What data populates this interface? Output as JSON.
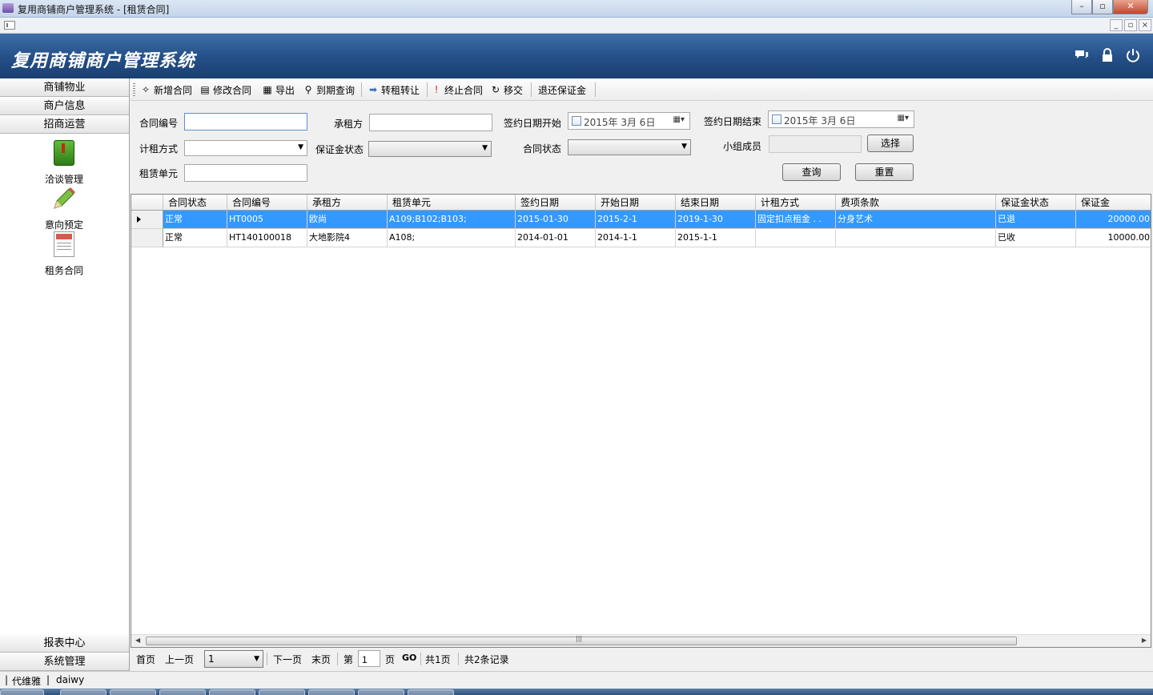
{
  "window": {
    "title": "复用商铺商户管理系统 - [租赁合同]",
    "controls": [
      "–",
      "▫",
      "✕"
    ],
    "mdi_controls": [
      "_",
      "▫",
      "×"
    ]
  },
  "banner": {
    "title": "复用商铺商户管理系统",
    "icons": [
      "chat-icon",
      "lock-icon",
      "power-icon"
    ]
  },
  "sidebar": {
    "top_headers": [
      "商铺物业",
      "商户信息",
      "招商运营"
    ],
    "items": [
      {
        "label": "洽谈管理",
        "icon": "green-book-icon"
      },
      {
        "label": "意向预定",
        "icon": "pencil-icon"
      },
      {
        "label": "租务合同",
        "icon": "contract-doc-icon"
      }
    ],
    "bottom_headers": [
      "报表中心",
      "系统管理"
    ]
  },
  "toolbar": {
    "buttons": [
      {
        "label": "新增合同",
        "icon": "new-icon"
      },
      {
        "label": "修改合同",
        "icon": "edit-icon"
      },
      {
        "label": "导出",
        "icon": "export-icon"
      },
      {
        "label": "到期查询",
        "icon": "search-icon"
      },
      {
        "label": "转租转让",
        "icon": "arrow-right-icon"
      },
      {
        "label": "终止合同",
        "icon": "exclamation-icon"
      },
      {
        "label": "移交",
        "icon": "refresh-icon"
      },
      {
        "label": "退还保证金",
        "icon": ""
      }
    ]
  },
  "filter": {
    "contract_no_label": "合同编号",
    "contract_no_value": "",
    "lessee_label": "承租方",
    "lessee_value": "",
    "sign_start_label": "签约日期开始",
    "sign_start_value": "2015年 3月 6日",
    "sign_end_label": "签约日期结束",
    "sign_end_value": "2015年 3月 6日",
    "rent_method_label": "计租方式",
    "rent_method_value": "",
    "deposit_status_label": "保证金状态",
    "deposit_status_value": "",
    "contract_status_label": "合同状态",
    "contract_status_value": "",
    "group_member_label": "小组成员",
    "group_member_value": "",
    "select_button": "选择",
    "unit_label": "租赁单元",
    "unit_value": "",
    "query_button": "查询",
    "reset_button": "重置"
  },
  "grid": {
    "columns": [
      "合同状态",
      "合同编号",
      "承租方",
      "租赁单元",
      "签约日期",
      "开始日期",
      "结束日期",
      "计租方式",
      "费项条款",
      "保证金状态",
      "保证金"
    ],
    "rows": [
      {
        "selected": true,
        "cells": [
          "正常",
          "HT0005",
          "欧尚",
          "A109;B102;B103;",
          "2015-01-30",
          "2015-2-1",
          "2019-1-30",
          "固定扣点租金 . .",
          "分身艺术",
          "已退",
          "20000.00"
        ]
      },
      {
        "selected": false,
        "cells": [
          "正常",
          "HT140100018",
          "大地影院4",
          "A108;",
          "2014-01-01",
          "2014-1-1",
          "2015-1-1",
          "",
          "",
          "已收",
          "10000.00"
        ]
      }
    ]
  },
  "pager": {
    "first": "首页",
    "prev": "上一页",
    "page_select": "1",
    "next": "下一页",
    "last": "末页",
    "page_prefix": "第",
    "page_input": "1",
    "page_suffix": "页",
    "go": "GO",
    "total_pages": "共1页",
    "total_records": "共2条记录"
  },
  "statusbar": {
    "company": "代维雅",
    "separator": "|",
    "user": "daiwy"
  },
  "colors": {
    "banner": "#234f86",
    "selection": "#3399ff"
  }
}
